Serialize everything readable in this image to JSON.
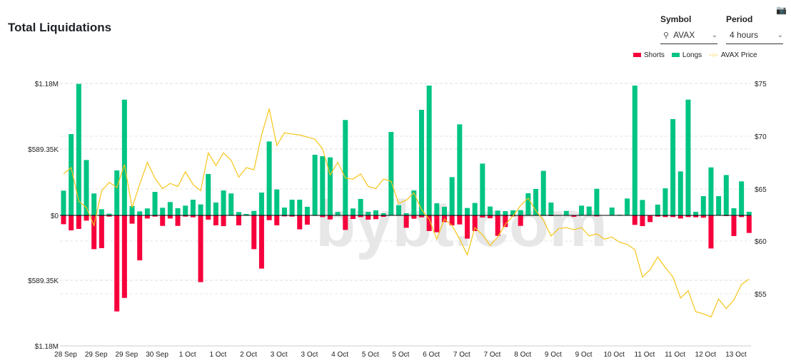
{
  "header": {
    "title": "Total Liquidations",
    "symbol_label": "Symbol",
    "symbol_value": "AVAX",
    "period_label": "Period",
    "period_value": "4 hours",
    "camera_icon": "camera-icon",
    "search_icon": "search-icon"
  },
  "watermark": "bybt.com",
  "chart_data": {
    "type": "bar",
    "title": "Total Liquidations",
    "legend": {
      "placement": "top-right",
      "entries": [
        "Shorts",
        "Longs",
        "AVAX Price"
      ]
    },
    "colors": {
      "Shorts": "#f6003c",
      "Longs": "#00c483",
      "AVAX Price": "#f5c518"
    },
    "grid": true,
    "left_axis": {
      "ticks": [
        "$1.18M",
        "$589.35K",
        "$0",
        "$589.35K",
        "$1.18M"
      ],
      "range": [
        -1180000,
        1180000
      ]
    },
    "right_axis": {
      "ticks": [
        "$75",
        "$70",
        "$65",
        "$60",
        "$55"
      ],
      "range": [
        50,
        75
      ]
    },
    "x_tick_labels": [
      "28 Sep",
      "29 Sep",
      "29 Sep",
      "30 Sep",
      "1 Oct",
      "1 Oct",
      "2 Oct",
      "3 Oct",
      "3 Oct",
      "4 Oct",
      "5 Oct",
      "5 Oct",
      "6 Oct",
      "7 Oct",
      "7 Oct",
      "8 Oct",
      "9 Oct",
      "9 Oct",
      "10 Oct",
      "11 Oct",
      "11 Oct",
      "12 Oct",
      "13 Oct"
    ],
    "series": [
      {
        "name": "Longs",
        "values": [
          221,
          727,
          1176,
          495,
          196,
          55,
          15,
          402,
          1035,
          83,
          36,
          62,
          210,
          68,
          119,
          64,
          87,
          140,
          98,
          370,
          115,
          223,
          196,
          30,
          13,
          40,
          204,
          661,
          232,
          70,
          140,
          140,
          77,
          542,
          529,
          519,
          30,
          853,
          62,
          147,
          32,
          45,
          19,
          746,
          91,
          19,
          223,
          944,
          1161,
          108,
          77,
          342,
          814,
          66,
          111,
          463,
          79,
          43,
          38,
          45,
          47,
          198,
          236,
          398,
          115,
          4,
          40,
          0,
          87,
          79,
          238,
          0,
          70,
          6,
          151,
          1161,
          138,
          0,
          96,
          242,
          861,
          393,
          1035,
          32,
          172,
          429,
          172,
          361,
          64,
          304,
          32
        ]
      },
      {
        "name": "Shorts",
        "values": [
          -79,
          -134,
          -121,
          -47,
          -302,
          -293,
          -11,
          -859,
          -738,
          -74,
          -402,
          -28,
          -11,
          -94,
          -28,
          -94,
          -11,
          -17,
          -597,
          -38,
          -89,
          -96,
          -4,
          -89,
          0,
          -302,
          -476,
          -43,
          -89,
          -9,
          -11,
          -125,
          -83,
          -4,
          -15,
          -36,
          0,
          -130,
          -32,
          -15,
          -38,
          -34,
          -13,
          -2,
          0,
          -111,
          -30,
          -17,
          -140,
          -151,
          -60,
          -89,
          -81,
          -208,
          -140,
          -19,
          -26,
          -183,
          -104,
          -9,
          -94,
          0,
          0,
          -4,
          -6,
          0,
          0,
          -13,
          0,
          0,
          -9,
          0,
          0,
          0,
          0,
          -85,
          -96,
          -60,
          -11,
          -15,
          -15,
          -28,
          -15,
          -17,
          -21,
          -296,
          0,
          -6,
          -185,
          -15,
          -157
        ]
      },
      {
        "name": "AVAX Price",
        "values": [
          66.4,
          67.0,
          63.8,
          63.2,
          61.5,
          64.8,
          65.6,
          65.1,
          67.3,
          63.2,
          65.4,
          67.5,
          66.0,
          65.0,
          65.5,
          65.2,
          66.6,
          65.4,
          64.8,
          68.4,
          67.2,
          68.4,
          67.7,
          66.1,
          67.0,
          66.8,
          70.1,
          72.6,
          69.1,
          70.3,
          70.2,
          70.1,
          69.9,
          69.7,
          68.8,
          66.3,
          67.5,
          66.0,
          65.9,
          66.4,
          65.2,
          65.0,
          65.9,
          65.7,
          63.6,
          63.9,
          64.6,
          63.0,
          62.1,
          60.2,
          62.1,
          61.5,
          60.2,
          58.7,
          61.3,
          60.6,
          59.6,
          60.4,
          61.6,
          62.4,
          63.4,
          64.1,
          62.9,
          62.0,
          60.5,
          61.2,
          61.3,
          61.1,
          61.3,
          60.5,
          60.7,
          60.2,
          60.4,
          59.9,
          59.7,
          59.2,
          56.6,
          57.3,
          58.5,
          57.5,
          56.6,
          54.6,
          55.3,
          53.3,
          53.1,
          52.8,
          54.5,
          53.6,
          54.4,
          55.9,
          56.4
        ]
      }
    ],
    "units": {
      "Longs": "thousand USD",
      "Shorts": "thousand USD",
      "AVAX Price": "USD"
    }
  }
}
